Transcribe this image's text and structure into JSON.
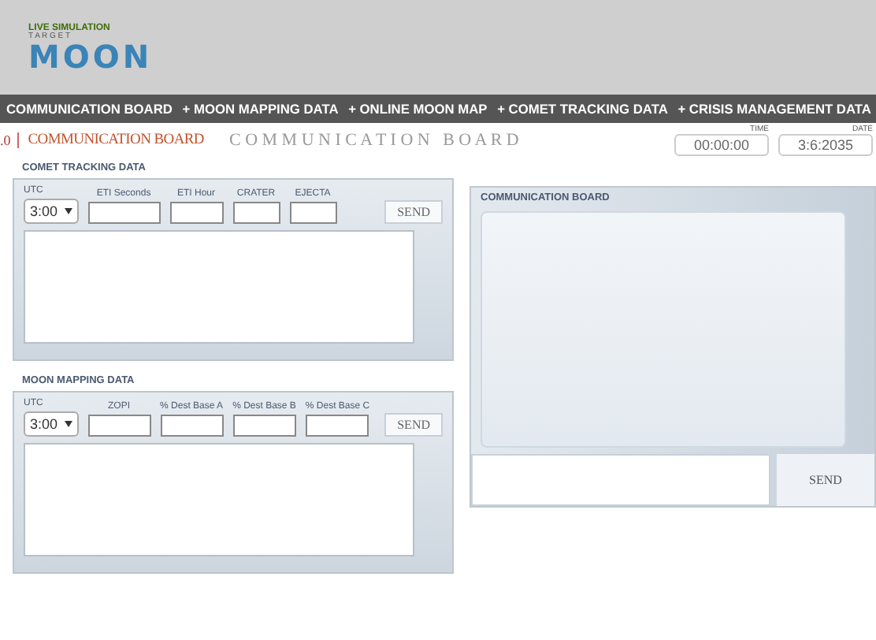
{
  "logo": {
    "tagline": "LIVE SIMULATION",
    "subtitle": "T A R G E T",
    "title": "MOON"
  },
  "nav": [
    {
      "label": "COMMUNICATION BOARD"
    },
    {
      "label": "+ MOON MAPPING DATA"
    },
    {
      "label": "+ ONLINE MOON MAP"
    },
    {
      "label": "+ COMET TRACKING DATA"
    },
    {
      "label": "+ CRISIS MANAGEMENT DATA"
    }
  ],
  "subheader": {
    "version": ".0",
    "section": "COMMUNICATION BOARD",
    "watermark": "C O M M U N I C A T I O N   B O A R D"
  },
  "time": {
    "label": "TIME",
    "value": "00:00:00"
  },
  "date": {
    "label": "DATE",
    "value": "3:6:2035"
  },
  "forms": [
    {
      "title": "COMET TRACKING DATA",
      "utc_label": "UTC",
      "utc_value": "3:00",
      "fields": [
        "ETI Seconds",
        "ETI Hour",
        "CRATER",
        "EJECTA"
      ],
      "send": "SEND"
    },
    {
      "title": "MOON MAPPING DATA",
      "utc_label": "UTC",
      "utc_value": "3:00",
      "fields": [
        "ZOPI",
        "% Dest Base A",
        "% Dest Base B",
        "% Dest Base C"
      ],
      "send": "SEND"
    }
  ],
  "board": {
    "title": "COMMUNICATION BOARD",
    "send": "SEND"
  }
}
